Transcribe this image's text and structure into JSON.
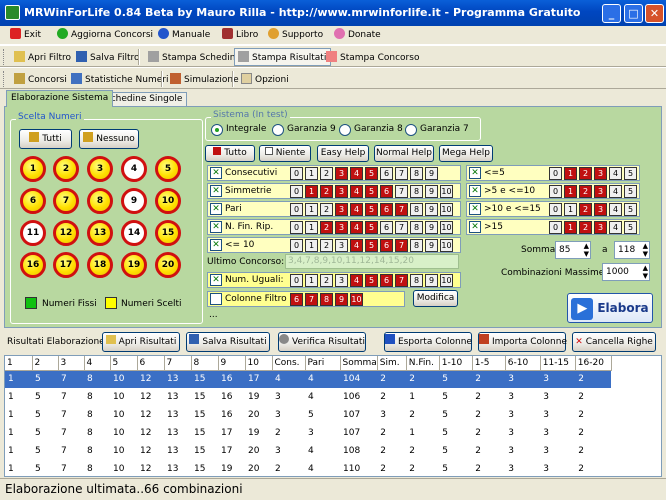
{
  "window": {
    "title": "MRWinForLife 0.84 Beta by Mauro Rilla - http://www.mrwinforlife.it - Programma Gratuito"
  },
  "menu": [
    "Exit",
    "Aggiorna Concorsi",
    "Manuale",
    "Libro",
    "Supporto",
    "Donate"
  ],
  "toolbar1": [
    "Apri Filtro",
    "Salva Filtro",
    "Stampa Schedine",
    "Stampa Risultati",
    "Stampa Concorso"
  ],
  "toolbar2": [
    "Concorsi",
    "Statistiche Numeri",
    "Simulazione",
    "Opzioni"
  ],
  "tabs": [
    "Elaborazione Sistema",
    "Schedine Singole"
  ],
  "scelta": {
    "title": "Scelta Numeri",
    "tutti": "Tutti",
    "nessuno": "Nessuno",
    "legend_fixed": "Numeri Fissi",
    "legend_chosen": "Numeri Scelti",
    "balls": [
      {
        "n": "1"
      },
      {
        "n": "2"
      },
      {
        "n": "3"
      },
      {
        "n": "4",
        "white": true
      },
      {
        "n": "5"
      },
      {
        "n": "6"
      },
      {
        "n": "7"
      },
      {
        "n": "8"
      },
      {
        "n": "9",
        "white": true
      },
      {
        "n": "10"
      },
      {
        "n": "11",
        "white": true
      },
      {
        "n": "12"
      },
      {
        "n": "13"
      },
      {
        "n": "14",
        "white": true
      },
      {
        "n": "15"
      },
      {
        "n": "16"
      },
      {
        "n": "17"
      },
      {
        "n": "18"
      },
      {
        "n": "19"
      },
      {
        "n": "20"
      }
    ]
  },
  "sistema": {
    "title": "Sistema (In test)",
    "options": [
      "Integrale",
      "Garanzia 9",
      "Garanzia 8",
      "Garanzia 7"
    ],
    "selected": "Integrale"
  },
  "filters": {
    "tutto": "Tutto",
    "niente": "Niente",
    "easy": "Easy Help",
    "normal": "Normal Help",
    "mega": "Mega Help",
    "rows": [
      {
        "label": "Consecutivi",
        "checked": true,
        "nums": [
          "0",
          "1",
          "2",
          "3",
          "4",
          "5",
          "6",
          "7",
          "8",
          "9"
        ],
        "red": [
          3,
          4,
          5
        ]
      },
      {
        "label": "Simmetrie",
        "checked": true,
        "nums": [
          "0",
          "1",
          "2",
          "3",
          "4",
          "5",
          "6",
          "7",
          "8",
          "9",
          "10"
        ],
        "red": [
          1,
          2,
          3,
          4,
          5,
          6
        ]
      },
      {
        "label": "Pari",
        "checked": true,
        "nums": [
          "0",
          "1",
          "2",
          "3",
          "4",
          "5",
          "6",
          "7",
          "8",
          "9",
          "10"
        ],
        "red": [
          3,
          4,
          5,
          6,
          7
        ]
      },
      {
        "label": "N. Fin. Rip.",
        "checked": true,
        "nums": [
          "0",
          "1",
          "2",
          "3",
          "4",
          "5",
          "6",
          "7",
          "8",
          "9",
          "10"
        ],
        "red": [
          2,
          3,
          4,
          5
        ]
      },
      {
        "label": "<= 10",
        "checked": true,
        "nums": [
          "0",
          "1",
          "2",
          "3",
          "4",
          "5",
          "6",
          "7",
          "8",
          "9",
          "10"
        ],
        "red": [
          4,
          5,
          6,
          7
        ]
      }
    ],
    "right_rows": [
      {
        "label": "<=5",
        "checked": true,
        "nums": [
          "0",
          "1",
          "2",
          "3",
          "4",
          "5"
        ],
        "red": [
          1,
          2,
          3
        ]
      },
      {
        "label": ">5 e <=10",
        "checked": true,
        "nums": [
          "0",
          "1",
          "2",
          "3",
          "4",
          "5"
        ],
        "red": [
          1,
          2,
          3
        ]
      },
      {
        "label": ">10 e <=15",
        "checked": true,
        "nums": [
          "0",
          "1",
          "2",
          "3",
          "4",
          "5"
        ],
        "red": [
          2,
          3
        ]
      },
      {
        "label": ">15",
        "checked": true,
        "nums": [
          "0",
          "1",
          "2",
          "3",
          "4",
          "5"
        ],
        "red": [
          1,
          2,
          3
        ]
      }
    ]
  },
  "somma": {
    "label": "Somma",
    "from": "85",
    "a_label": "a",
    "to": "118"
  },
  "combinazioni": {
    "label": "Combinazioni Massime:",
    "value": "1000"
  },
  "ultimo": {
    "label": "Ultimo Concorso:",
    "value": "3,4,7,8,9,10,11,12,14,15,20"
  },
  "numuguali": {
    "label": "Num. Uguali:",
    "checked": true,
    "nums": [
      "0",
      "1",
      "2",
      "3",
      "4",
      "5",
      "6",
      "7",
      "8",
      "9",
      "10"
    ],
    "red": [
      4,
      5,
      6,
      7
    ]
  },
  "colonne": {
    "label": "Colonne Filtro",
    "checked": false,
    "nums": [
      "6",
      "7",
      "8",
      "9",
      "10"
    ],
    "modifica": "Modifica",
    "dots": "..."
  },
  "elabora": "Elabora",
  "results": {
    "label": "Risultati Elaborazione",
    "buttons": [
      "Apri Risultati",
      "Salva Risultati",
      "Verifica Risultati",
      "Esporta Colonne",
      "Importa Colonne",
      "Cancella Righe"
    ],
    "headers": [
      "1",
      "2",
      "3",
      "4",
      "5",
      "6",
      "7",
      "8",
      "9",
      "10",
      "Cons.",
      "Pari",
      "Somma",
      "Sim.",
      "N.Fin.",
      "1-10",
      "1-5",
      "6-10",
      "11-15",
      "16-20"
    ],
    "rows": [
      [
        "1",
        "5",
        "7",
        "8",
        "10",
        "12",
        "13",
        "15",
        "16",
        "17",
        "4",
        "4",
        "104",
        "2",
        "2",
        "5",
        "2",
        "3",
        "3",
        "2"
      ],
      [
        "1",
        "5",
        "7",
        "8",
        "10",
        "12",
        "13",
        "15",
        "16",
        "19",
        "3",
        "4",
        "106",
        "2",
        "1",
        "5",
        "2",
        "3",
        "3",
        "2"
      ],
      [
        "1",
        "5",
        "7",
        "8",
        "10",
        "12",
        "13",
        "15",
        "16",
        "20",
        "3",
        "5",
        "107",
        "3",
        "2",
        "5",
        "2",
        "3",
        "3",
        "2"
      ],
      [
        "1",
        "5",
        "7",
        "8",
        "10",
        "12",
        "13",
        "15",
        "17",
        "19",
        "2",
        "3",
        "107",
        "2",
        "1",
        "5",
        "2",
        "3",
        "3",
        "2"
      ],
      [
        "1",
        "5",
        "7",
        "8",
        "10",
        "12",
        "13",
        "15",
        "17",
        "20",
        "3",
        "4",
        "108",
        "2",
        "2",
        "5",
        "2",
        "3",
        "3",
        "2"
      ],
      [
        "1",
        "5",
        "7",
        "8",
        "10",
        "12",
        "13",
        "15",
        "19",
        "20",
        "2",
        "4",
        "110",
        "2",
        "2",
        "5",
        "2",
        "3",
        "3",
        "2"
      ]
    ]
  },
  "status": "Elaborazione ultimata..66 combinazioni",
  "colors": {
    "red": "#c01010",
    "ball_yellow": "#ffe000",
    "panel": "#b8d8a0",
    "selection": "#3b6fc5"
  }
}
